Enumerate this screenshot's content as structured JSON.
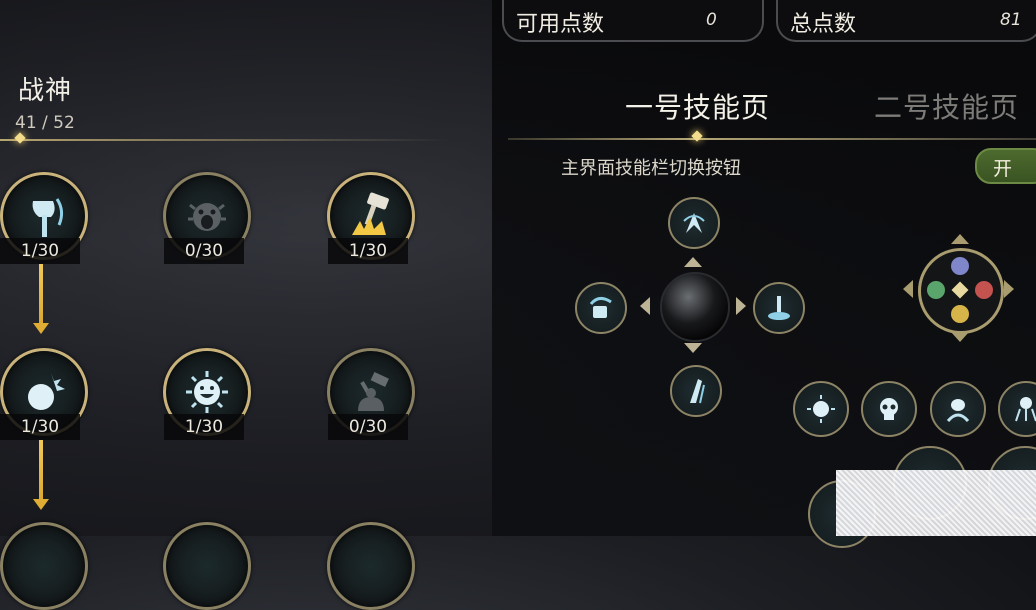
{
  "colors": {
    "accent_gold": "#f3dc8c",
    "skill_glow": "#bfe4f0",
    "arrow": "#e0ad34",
    "toggle_green": "#4d6a2e"
  },
  "stats": {
    "available_label": "可用点数",
    "available_value": "0",
    "total_label": "总点数",
    "total_value": "81"
  },
  "tree": {
    "title": "战神",
    "progress": "41 / 52",
    "skills": [
      {
        "icon": "axe-icon",
        "level": "1/30"
      },
      {
        "icon": "roaring-face-icon",
        "level": "0/30"
      },
      {
        "icon": "hammer-smash-icon",
        "level": "1/30"
      },
      {
        "icon": "bomb-spikes-icon",
        "level": "1/30"
      },
      {
        "icon": "sun-face-icon",
        "level": "1/30"
      },
      {
        "icon": "hammer-strike-icon",
        "level": "0/30"
      }
    ]
  },
  "pages": {
    "page1": "一号技能页",
    "page2": "二号技能页"
  },
  "switch": {
    "label": "主界面技能栏切换按钮",
    "toggle_text": "开"
  },
  "quickbar": {
    "center_icon": "orb-icon",
    "slots": [
      "slash-icon",
      "shield-bash-icon",
      "totem-icon",
      "dash-icon"
    ]
  },
  "bottom_skills": [
    "sun-face-icon",
    "skull-icon",
    "spider-icon",
    "tentacle-icon"
  ]
}
